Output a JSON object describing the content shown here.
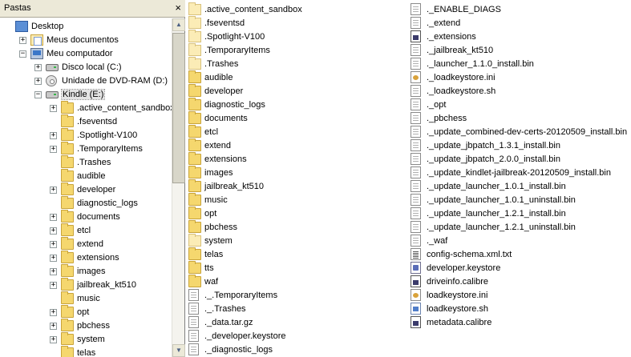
{
  "explorer_pane": {
    "title": "Pastas",
    "close_glyph": "×"
  },
  "tree": [
    {
      "label": "Desktop",
      "icon": "desktop-icon",
      "expander": ""
    },
    {
      "label": "Meus documentos",
      "icon": "my-documents-icon",
      "expander": "+"
    },
    {
      "label": "Meu computador",
      "icon": "my-computer-icon",
      "expander": "−"
    },
    {
      "label": "Disco local (C:)",
      "icon": "hard-drive-icon",
      "expander": "+"
    },
    {
      "label": "Unidade de DVD-RAM (D:)",
      "icon": "dvd-drive-icon",
      "expander": "+"
    },
    {
      "label": "Kindle (E:)",
      "icon": "removable-drive-icon",
      "expander": "−",
      "selected": true
    },
    {
      "label": ".active_content_sandbox",
      "icon": "folder-icon",
      "expander": "+"
    },
    {
      "label": ".fseventsd",
      "icon": "folder-icon",
      "expander": ""
    },
    {
      "label": ".Spotlight-V100",
      "icon": "folder-icon",
      "expander": "+"
    },
    {
      "label": ".TemporaryItems",
      "icon": "folder-icon",
      "expander": "+"
    },
    {
      "label": ".Trashes",
      "icon": "folder-icon",
      "expander": ""
    },
    {
      "label": "audible",
      "icon": "folder-icon",
      "expander": ""
    },
    {
      "label": "developer",
      "icon": "folder-icon",
      "expander": "+"
    },
    {
      "label": "diagnostic_logs",
      "icon": "folder-icon",
      "expander": ""
    },
    {
      "label": "documents",
      "icon": "folder-icon",
      "expander": "+"
    },
    {
      "label": "etcl",
      "icon": "folder-icon",
      "expander": "+"
    },
    {
      "label": "extend",
      "icon": "folder-icon",
      "expander": "+"
    },
    {
      "label": "extensions",
      "icon": "folder-icon",
      "expander": "+"
    },
    {
      "label": "images",
      "icon": "folder-icon",
      "expander": "+"
    },
    {
      "label": "jailbreak_kt510",
      "icon": "folder-icon",
      "expander": "+"
    },
    {
      "label": "music",
      "icon": "folder-icon",
      "expander": ""
    },
    {
      "label": "opt",
      "icon": "folder-icon",
      "expander": "+"
    },
    {
      "label": "pbchess",
      "icon": "folder-icon",
      "expander": "+"
    },
    {
      "label": "system",
      "icon": "folder-icon",
      "expander": "+"
    },
    {
      "label": "telas",
      "icon": "folder-icon",
      "expander": ""
    }
  ],
  "files_col1": [
    {
      "name": ".active_content_sandbox",
      "icon": "folder-hidden-icon"
    },
    {
      "name": ".fseventsd",
      "icon": "folder-hidden-icon"
    },
    {
      "name": ".Spotlight-V100",
      "icon": "folder-hidden-icon"
    },
    {
      "name": ".TemporaryItems",
      "icon": "folder-hidden-icon"
    },
    {
      "name": ".Trashes",
      "icon": "folder-hidden-icon"
    },
    {
      "name": "audible",
      "icon": "folder-icon"
    },
    {
      "name": "developer",
      "icon": "folder-icon"
    },
    {
      "name": "diagnostic_logs",
      "icon": "folder-icon"
    },
    {
      "name": "documents",
      "icon": "folder-icon"
    },
    {
      "name": "etcl",
      "icon": "folder-icon"
    },
    {
      "name": "extend",
      "icon": "folder-icon"
    },
    {
      "name": "extensions",
      "icon": "folder-icon"
    },
    {
      "name": "images",
      "icon": "folder-icon"
    },
    {
      "name": "jailbreak_kt510",
      "icon": "folder-icon"
    },
    {
      "name": "music",
      "icon": "folder-icon"
    },
    {
      "name": "opt",
      "icon": "folder-icon"
    },
    {
      "name": "pbchess",
      "icon": "folder-icon"
    },
    {
      "name": "system",
      "icon": "folder-hidden-icon"
    },
    {
      "name": "telas",
      "icon": "folder-icon"
    },
    {
      "name": "tts",
      "icon": "folder-icon"
    },
    {
      "name": "waf",
      "icon": "folder-icon"
    },
    {
      "name": "._.TemporaryItems",
      "icon": "file-icon"
    },
    {
      "name": "._.Trashes",
      "icon": "file-icon"
    },
    {
      "name": "._data.tar.gz",
      "icon": "file-icon"
    },
    {
      "name": "._developer.keystore",
      "icon": "file-icon"
    },
    {
      "name": "._diagnostic_logs",
      "icon": "file-icon"
    }
  ],
  "files_col2": [
    {
      "name": "._ENABLE_DIAGS",
      "icon": "file-icon"
    },
    {
      "name": "._extend",
      "icon": "file-icon"
    },
    {
      "name": "._extensions",
      "icon": "binary-file-icon"
    },
    {
      "name": "._jailbreak_kt510",
      "icon": "file-icon"
    },
    {
      "name": "._launcher_1.1.0_install.bin",
      "icon": "file-icon"
    },
    {
      "name": "._loadkeystore.ini",
      "icon": "ini-file-icon"
    },
    {
      "name": "._loadkeystore.sh",
      "icon": "file-icon"
    },
    {
      "name": "._opt",
      "icon": "file-icon"
    },
    {
      "name": "._pbchess",
      "icon": "file-icon"
    },
    {
      "name": "._update_combined-dev-certs-20120509_install.bin",
      "icon": "file-icon"
    },
    {
      "name": "._update_jbpatch_1.3.1_install.bin",
      "icon": "file-icon"
    },
    {
      "name": "._update_jbpatch_2.0.0_install.bin",
      "icon": "file-icon"
    },
    {
      "name": "._update_kindlet-jailbreak-20120509_install.bin",
      "icon": "file-icon"
    },
    {
      "name": "._update_launcher_1.0.1_install.bin",
      "icon": "file-icon"
    },
    {
      "name": "._update_launcher_1.0.1_uninstall.bin",
      "icon": "file-icon"
    },
    {
      "name": "._update_launcher_1.2.1_install.bin",
      "icon": "file-icon"
    },
    {
      "name": "._update_launcher_1.2.1_uninstall.bin",
      "icon": "file-icon"
    },
    {
      "name": "._waf",
      "icon": "file-icon"
    },
    {
      "name": "config-schema.xml.txt",
      "icon": "text-file-icon"
    },
    {
      "name": "developer.keystore",
      "icon": "certificate-file-icon"
    },
    {
      "name": "driveinfo.calibre",
      "icon": "binary-file-icon"
    },
    {
      "name": "loadkeystore.ini",
      "icon": "ini-file-icon"
    },
    {
      "name": "loadkeystore.sh",
      "icon": "script-file-icon"
    },
    {
      "name": "metadata.calibre",
      "icon": "binary-file-icon"
    }
  ],
  "scrollbar": {
    "up_glyph": "▲",
    "down_glyph": "▼"
  }
}
